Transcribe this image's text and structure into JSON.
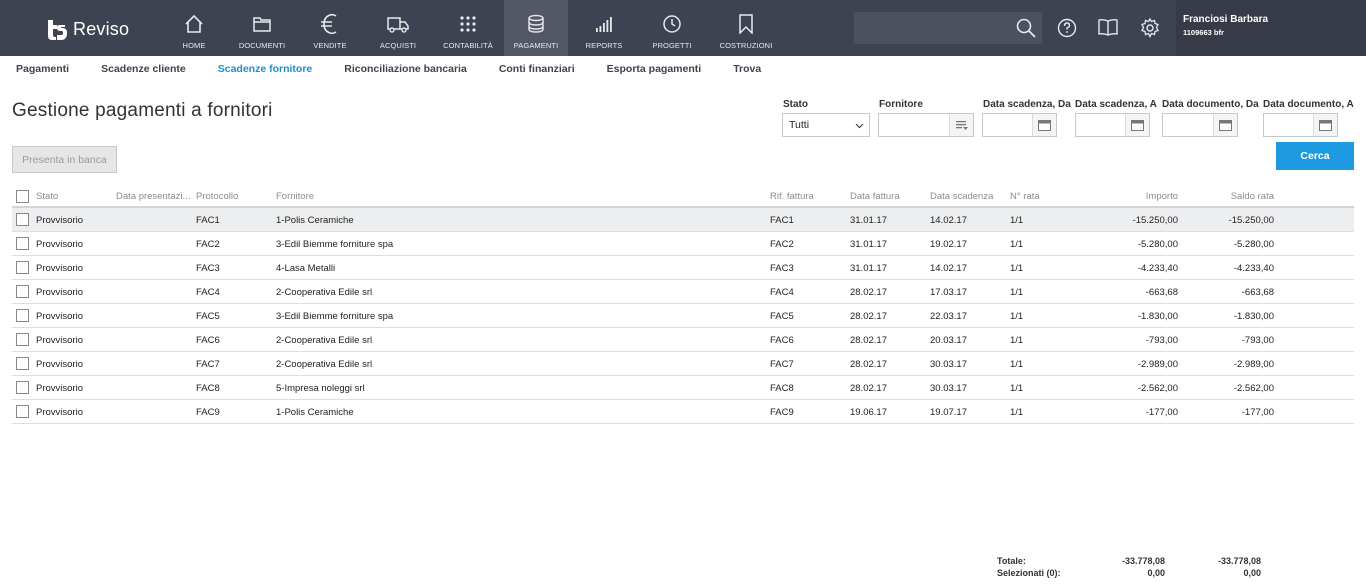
{
  "app": {
    "name": "Reviso"
  },
  "nav": [
    {
      "label": "HOME",
      "icon": "home-icon"
    },
    {
      "label": "DOCUMENTI",
      "icon": "folder-icon"
    },
    {
      "label": "VENDITE",
      "icon": "euro-icon"
    },
    {
      "label": "ACQUISTI",
      "icon": "truck-icon"
    },
    {
      "label": "CONTABILITÀ",
      "icon": "grid-icon"
    },
    {
      "label": "PAGAMENTI",
      "icon": "coins-icon",
      "active": true
    },
    {
      "label": "REPORTS",
      "icon": "bar-chart-icon"
    },
    {
      "label": "PROGETTI",
      "icon": "clock-icon"
    },
    {
      "label": "COSTRUZIONI",
      "icon": "bookmark-icon"
    }
  ],
  "user": {
    "name": "Franciosi Barbara",
    "id": "1109663 bfr"
  },
  "subnav": [
    {
      "label": "Pagamenti"
    },
    {
      "label": "Scadenze cliente"
    },
    {
      "label": "Scadenze fornitore",
      "active": true
    },
    {
      "label": "Riconciliazione bancaria"
    },
    {
      "label": "Conti finanziari"
    },
    {
      "label": "Esporta pagamenti"
    },
    {
      "label": "Trova"
    }
  ],
  "page": {
    "title": "Gestione pagamenti a fornitori"
  },
  "filters": {
    "stato_label": "Stato",
    "stato_value": "Tutti",
    "fornitore_label": "Fornitore",
    "data_scadenza_da_label": "Data scadenza, Da",
    "data_scadenza_a_label": "Data scadenza, A",
    "data_documento_da_label": "Data documento, Da",
    "data_documento_a_label": "Data documento, A"
  },
  "buttons": {
    "presenta": "Presenta in banca",
    "cerca": "Cerca"
  },
  "table": {
    "headers": {
      "stato": "Stato",
      "data_presentazione": "Data presentazi...",
      "protocollo": "Protocollo",
      "fornitore": "Fornitore",
      "rif_fattura": "Rif. fattura",
      "data_fattura": "Data fattura",
      "data_scadenza": "Data scadenza",
      "n_rata": "N° rata",
      "importo": "Importo",
      "saldo_rata": "Saldo rata"
    },
    "rows": [
      {
        "stato": "Provvisorio",
        "protocollo": "FAC1",
        "fornitore": "1-Polis Ceramiche",
        "rif": "FAC1",
        "data_fattura": "31.01.17",
        "data_scadenza": "14.02.17",
        "rata": "1/1",
        "importo": "-15.250,00",
        "saldo": "-15.250,00"
      },
      {
        "stato": "Provvisorio",
        "protocollo": "FAC2",
        "fornitore": "3-Edil Biemme forniture spa",
        "rif": "FAC2",
        "data_fattura": "31.01.17",
        "data_scadenza": "19.02.17",
        "rata": "1/1",
        "importo": "-5.280,00",
        "saldo": "-5.280,00"
      },
      {
        "stato": "Provvisorio",
        "protocollo": "FAC3",
        "fornitore": "4-Lasa Metalli",
        "rif": "FAC3",
        "data_fattura": "31.01.17",
        "data_scadenza": "14.02.17",
        "rata": "1/1",
        "importo": "-4.233,40",
        "saldo": "-4.233,40"
      },
      {
        "stato": "Provvisorio",
        "protocollo": "FAC4",
        "fornitore": "2-Cooperativa Edile srl",
        "rif": "FAC4",
        "data_fattura": "28.02.17",
        "data_scadenza": "17.03.17",
        "rata": "1/1",
        "importo": "-663,68",
        "saldo": "-663,68"
      },
      {
        "stato": "Provvisorio",
        "protocollo": "FAC5",
        "fornitore": "3-Edil Biemme forniture spa",
        "rif": "FAC5",
        "data_fattura": "28.02.17",
        "data_scadenza": "22.03.17",
        "rata": "1/1",
        "importo": "-1.830,00",
        "saldo": "-1.830,00"
      },
      {
        "stato": "Provvisorio",
        "protocollo": "FAC6",
        "fornitore": "2-Cooperativa Edile srl",
        "rif": "FAC6",
        "data_fattura": "28.02.17",
        "data_scadenza": "20.03.17",
        "rata": "1/1",
        "importo": "-793,00",
        "saldo": "-793,00"
      },
      {
        "stato": "Provvisorio",
        "protocollo": "FAC7",
        "fornitore": "2-Cooperativa Edile srl",
        "rif": "FAC7",
        "data_fattura": "28.02.17",
        "data_scadenza": "30.03.17",
        "rata": "1/1",
        "importo": "-2.989,00",
        "saldo": "-2.989,00"
      },
      {
        "stato": "Provvisorio",
        "protocollo": "FAC8",
        "fornitore": "5-Impresa noleggi srl",
        "rif": "FAC8",
        "data_fattura": "28.02.17",
        "data_scadenza": "30.03.17",
        "rata": "1/1",
        "importo": "-2.562,00",
        "saldo": "-2.562,00"
      },
      {
        "stato": "Provvisorio",
        "protocollo": "FAC9",
        "fornitore": "1-Polis Ceramiche",
        "rif": "FAC9",
        "data_fattura": "19.06.17",
        "data_scadenza": "19.07.17",
        "rata": "1/1",
        "importo": "-177,00",
        "saldo": "-177,00"
      }
    ]
  },
  "totals": {
    "totale_label": "Totale:",
    "totale_importo": "-33.778,08",
    "totale_saldo": "-33.778,08",
    "selezionati_label": "Selezionati (0):",
    "selezionati_importo": "0,00",
    "selezionati_saldo": "0,00"
  },
  "colors": {
    "topbar": "#3d4350",
    "active_nav": "#525866",
    "accent": "#1e9be0",
    "active_subnav": "#1e90cc"
  }
}
